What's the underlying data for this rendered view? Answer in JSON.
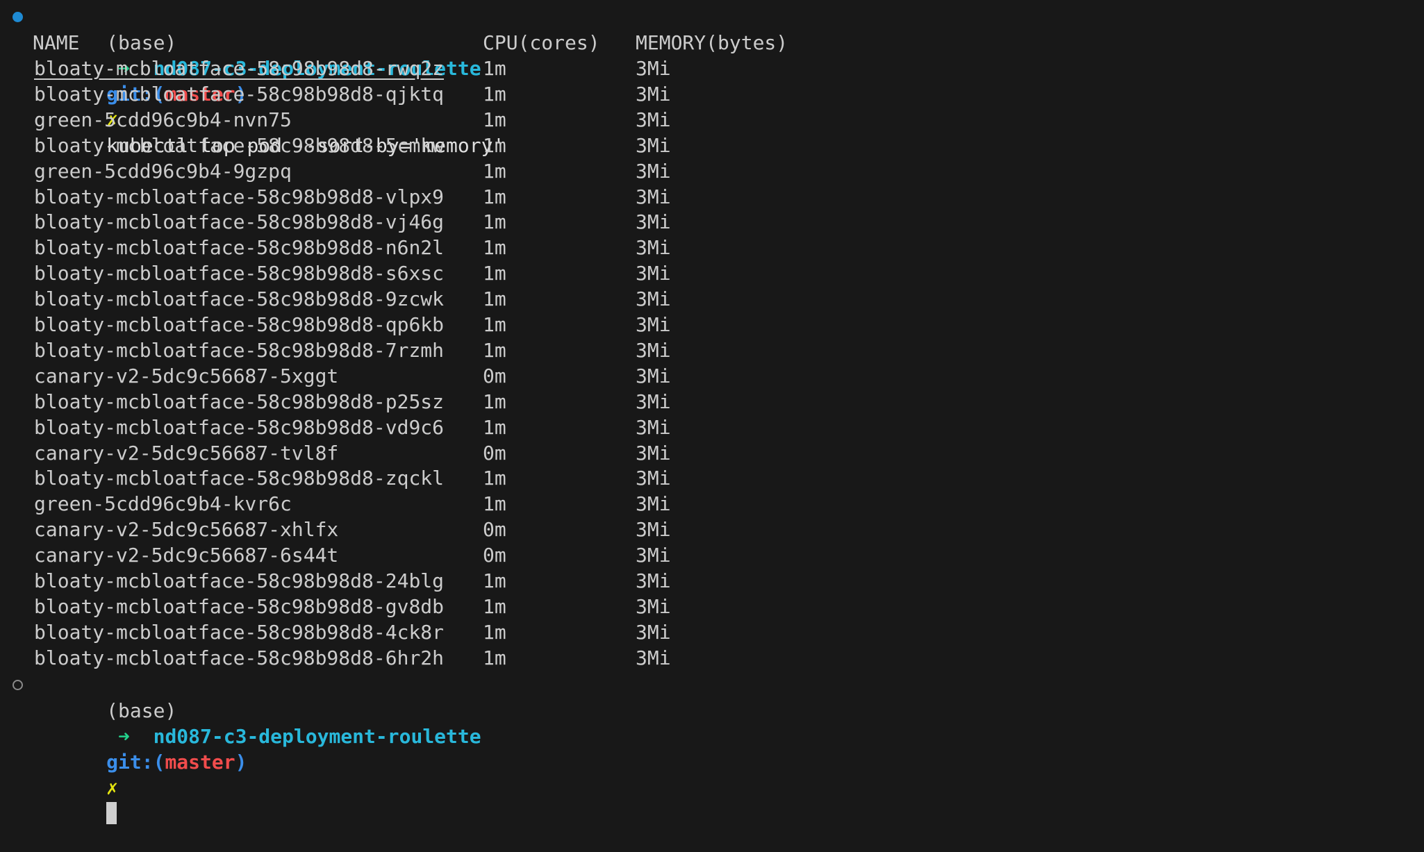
{
  "prompt": {
    "env": "(base)",
    "arrow": "➜",
    "directory": "nd087-c3-deployment-roulette",
    "git_label": "git:(",
    "branch": "master",
    "git_close": ")",
    "dirty_mark": "✗"
  },
  "command": "kubectl top pod --sort-by='memory'",
  "table": {
    "headers": [
      "NAME",
      "CPU(cores)",
      "MEMORY(bytes)"
    ],
    "rows": [
      {
        "name": "bloaty-mcbloatface-58c98b98d8-rwq2z",
        "cpu": "1m",
        "memory": "3Mi"
      },
      {
        "name": "bloaty-mcbloatface-58c98b98d8-qjktq",
        "cpu": "1m",
        "memory": "3Mi"
      },
      {
        "name": "green-5cdd96c9b4-nvn75",
        "cpu": "1m",
        "memory": "3Mi"
      },
      {
        "name": "bloaty-mcbloatface-58c98b98d8-5cmkw",
        "cpu": "1m",
        "memory": "3Mi"
      },
      {
        "name": "green-5cdd96c9b4-9gzpq",
        "cpu": "1m",
        "memory": "3Mi"
      },
      {
        "name": "bloaty-mcbloatface-58c98b98d8-vlpx9",
        "cpu": "1m",
        "memory": "3Mi"
      },
      {
        "name": "bloaty-mcbloatface-58c98b98d8-vj46g",
        "cpu": "1m",
        "memory": "3Mi"
      },
      {
        "name": "bloaty-mcbloatface-58c98b98d8-n6n2l",
        "cpu": "1m",
        "memory": "3Mi"
      },
      {
        "name": "bloaty-mcbloatface-58c98b98d8-s6xsc",
        "cpu": "1m",
        "memory": "3Mi"
      },
      {
        "name": "bloaty-mcbloatface-58c98b98d8-9zcwk",
        "cpu": "1m",
        "memory": "3Mi"
      },
      {
        "name": "bloaty-mcbloatface-58c98b98d8-qp6kb",
        "cpu": "1m",
        "memory": "3Mi"
      },
      {
        "name": "bloaty-mcbloatface-58c98b98d8-7rzmh",
        "cpu": "1m",
        "memory": "3Mi"
      },
      {
        "name": "canary-v2-5dc9c56687-5xggt",
        "cpu": "0m",
        "memory": "3Mi"
      },
      {
        "name": "bloaty-mcbloatface-58c98b98d8-p25sz",
        "cpu": "1m",
        "memory": "3Mi"
      },
      {
        "name": "bloaty-mcbloatface-58c98b98d8-vd9c6",
        "cpu": "1m",
        "memory": "3Mi"
      },
      {
        "name": "canary-v2-5dc9c56687-tvl8f",
        "cpu": "0m",
        "memory": "3Mi"
      },
      {
        "name": "bloaty-mcbloatface-58c98b98d8-zqckl",
        "cpu": "1m",
        "memory": "3Mi"
      },
      {
        "name": "green-5cdd96c9b4-kvr6c",
        "cpu": "1m",
        "memory": "3Mi"
      },
      {
        "name": "canary-v2-5dc9c56687-xhlfx",
        "cpu": "0m",
        "memory": "3Mi"
      },
      {
        "name": "canary-v2-5dc9c56687-6s44t",
        "cpu": "0m",
        "memory": "3Mi"
      },
      {
        "name": "bloaty-mcbloatface-58c98b98d8-24blg",
        "cpu": "1m",
        "memory": "3Mi"
      },
      {
        "name": "bloaty-mcbloatface-58c98b98d8-gv8db",
        "cpu": "1m",
        "memory": "3Mi"
      },
      {
        "name": "bloaty-mcbloatface-58c98b98d8-4ck8r",
        "cpu": "1m",
        "memory": "3Mi"
      },
      {
        "name": "bloaty-mcbloatface-58c98b98d8-6hr2h",
        "cpu": "1m",
        "memory": "3Mi"
      }
    ]
  },
  "colors": {
    "background": "#181818",
    "text": "#cccccc",
    "arrow": "#23d18b",
    "directory": "#29b8db",
    "git": "#3b8eea",
    "branch": "#f14c4c",
    "dirty_mark": "#e5e510",
    "status_dot_success": "#1e8ad3"
  },
  "icons": {
    "first_prompt_status": "filled-circle-icon",
    "second_prompt_status": "hollow-circle-icon"
  }
}
